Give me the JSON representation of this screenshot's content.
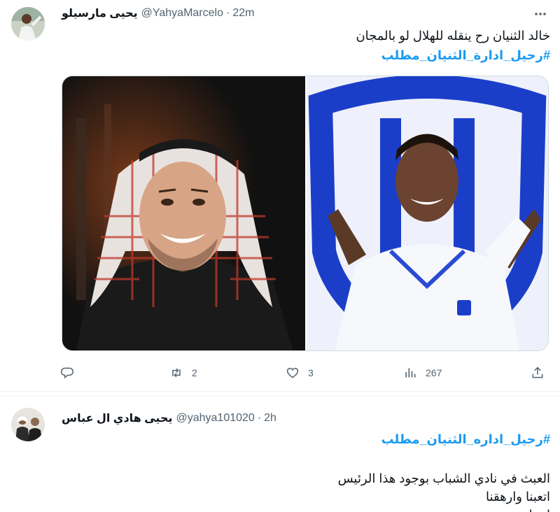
{
  "tweets": [
    {
      "display_name": "يحيى مارسيلو",
      "handle": "@YahyaMarcelo",
      "separator": "·",
      "time": "22m",
      "text_line": "خالد الثنيان رح ينقله للهلال لو بالمجان",
      "hashtag": "#رحيل_ادارة_الثنيان_مطلب",
      "actions": {
        "reply_count": "",
        "retweet_count": "2",
        "like_count": "3",
        "views_count": "267"
      },
      "icons": [
        "more-icon",
        "reply-icon",
        "retweet-icon",
        "like-icon",
        "views-icon",
        "share-icon"
      ]
    },
    {
      "display_name": "يحيى هادي ال عباس",
      "handle": "@yahya101020",
      "separator": "·",
      "time": "2h",
      "hashtag": "#رحيل_اداره_الثنيان_مطلب",
      "text_lines": [
        "العبث في نادي الشباب بوجود هذا الرئيس",
        "اتعبنا وارهقنا",
        "ارحل ...."
      ]
    }
  ],
  "colors": {
    "accent": "#1d9bf0",
    "muted": "#536471",
    "text": "#0f1419",
    "hilal_blue": "#1b3ec9"
  }
}
